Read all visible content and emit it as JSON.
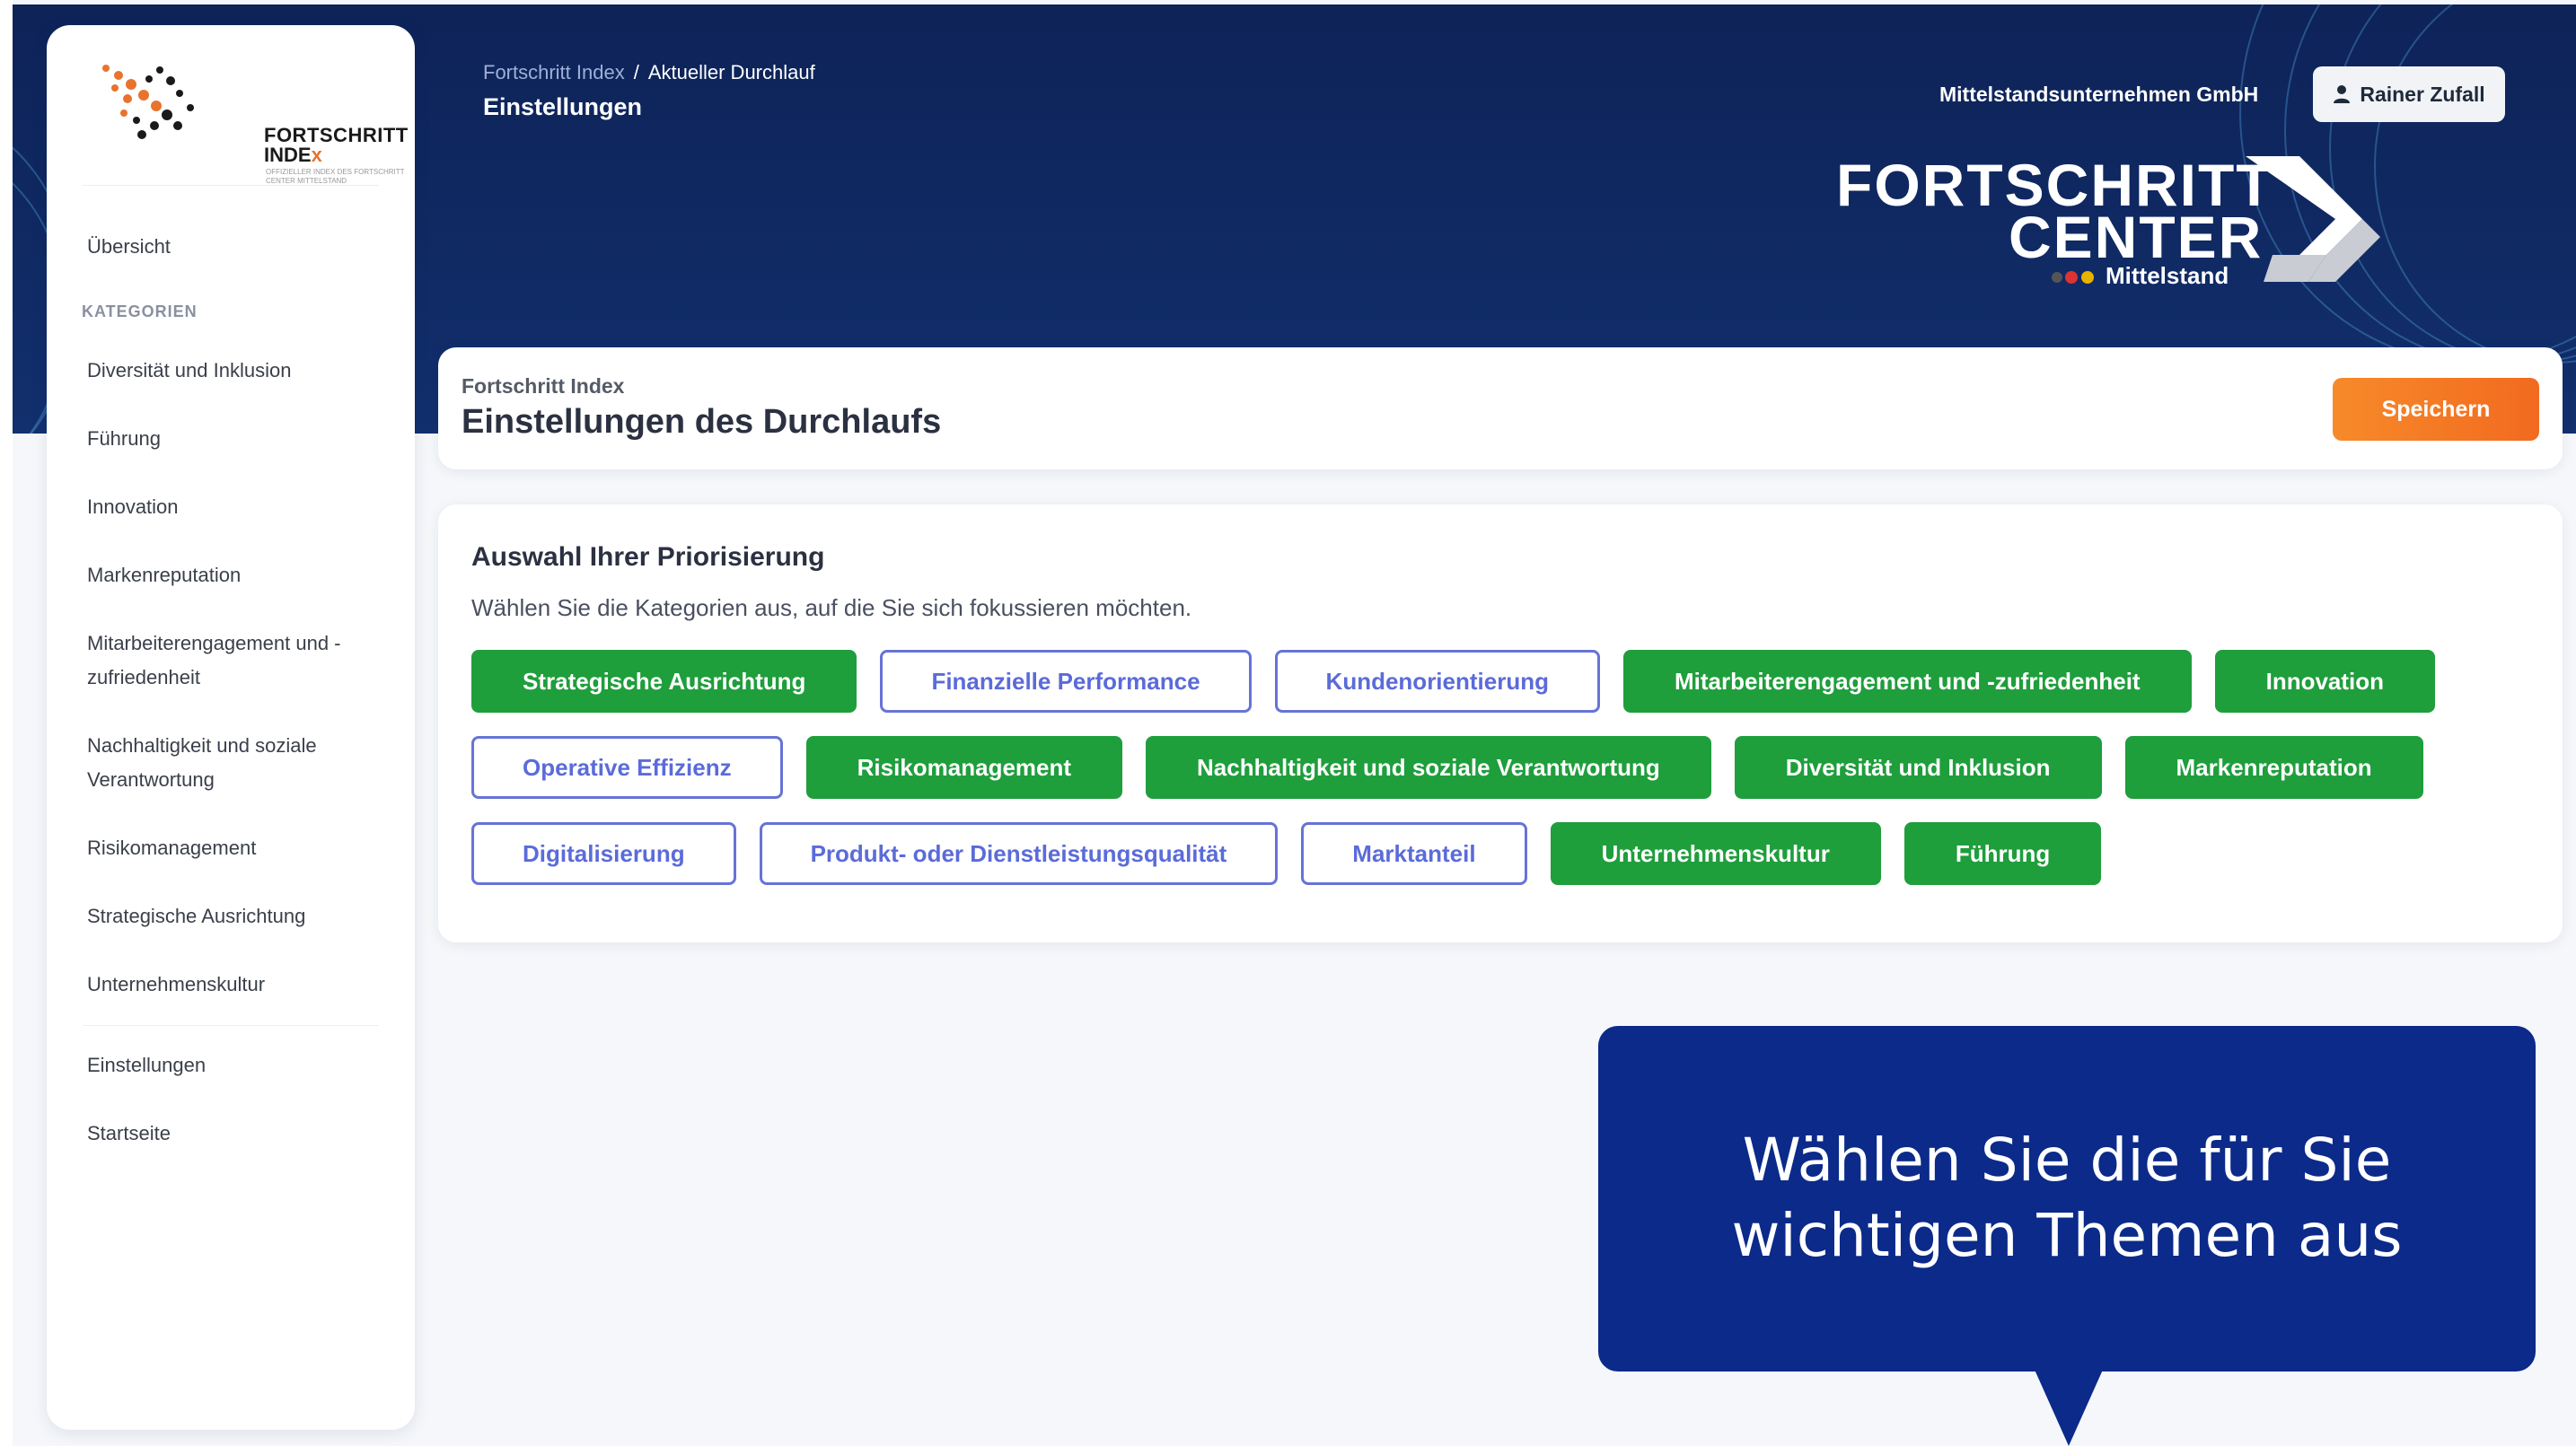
{
  "sidebar": {
    "logo": {
      "line1": "FORTSCHRITT",
      "line2_main": "INDE",
      "line2_accent": "x",
      "tagline": "OFFIZIELLER INDEX DES FORTSCHRITT CENTER MITTELSTAND"
    },
    "overview": "Übersicht",
    "categories_heading": "KATEGORIEN",
    "items": [
      "Diversität und Inklusion",
      "Führung",
      "Innovation",
      "Markenreputation",
      "Mitarbeiterengagement und -zufriedenheit",
      "Nachhaltigkeit und soziale Verantwortung",
      "Risikomanagement",
      "Strategische Ausrichtung",
      "Unternehmenskultur"
    ],
    "settings": "Einstellungen",
    "home": "Startseite"
  },
  "header": {
    "breadcrumb": {
      "root": "Fortschritt Index",
      "separator": "/",
      "current": "Aktueller Durchlauf"
    },
    "title": "Einstellungen",
    "company": "Mittelstandsunternehmen GmbH",
    "user": "Rainer Zufall",
    "brand": {
      "line1": "FORTSCHRITT",
      "line2": "CENTER",
      "line3": "Mittelstand"
    }
  },
  "page_head": {
    "subtitle": "Fortschritt Index",
    "title": "Einstellungen des Durchlaufs",
    "save_label": "Speichern"
  },
  "priorities": {
    "heading": "Auswahl Ihrer Priorisierung",
    "description": "Wählen Sie die Kategorien aus, auf die Sie sich fokussieren möchten.",
    "rows": [
      [
        {
          "label": "Strategische Ausrichtung",
          "selected": true
        },
        {
          "label": "Finanzielle Performance",
          "selected": false
        },
        {
          "label": "Kundenorientierung",
          "selected": false
        },
        {
          "label": "Mitarbeiterengagement und -zufriedenheit",
          "selected": true
        },
        {
          "label": "Innovation",
          "selected": true
        }
      ],
      [
        {
          "label": "Operative Effizienz",
          "selected": false
        },
        {
          "label": "Risikomanagement",
          "selected": true
        },
        {
          "label": "Nachhaltigkeit und soziale Verantwortung",
          "selected": true
        },
        {
          "label": "Diversität und Inklusion",
          "selected": true
        },
        {
          "label": "Markenreputation",
          "selected": true
        }
      ],
      [
        {
          "label": "Digitalisierung",
          "selected": false
        },
        {
          "label": "Produkt- oder Dienstleistungsqualität",
          "selected": false
        },
        {
          "label": "Marktanteil",
          "selected": false
        },
        {
          "label": "Unternehmenskultur",
          "selected": true
        },
        {
          "label": "Führung",
          "selected": true
        }
      ]
    ]
  },
  "callout": {
    "line1": "Wählen Sie die für Sie",
    "line2": "wichtigen Themen aus"
  },
  "colors": {
    "header_bg": "#102a64",
    "chip_selected": "#1f9e3c",
    "chip_unselected_border": "#6674d6",
    "save_button": "#f47a24",
    "callout_bg": "#0b2a8a"
  },
  "icons": {
    "user": "user-icon",
    "brand_arrow": "chevron-right-icon"
  }
}
